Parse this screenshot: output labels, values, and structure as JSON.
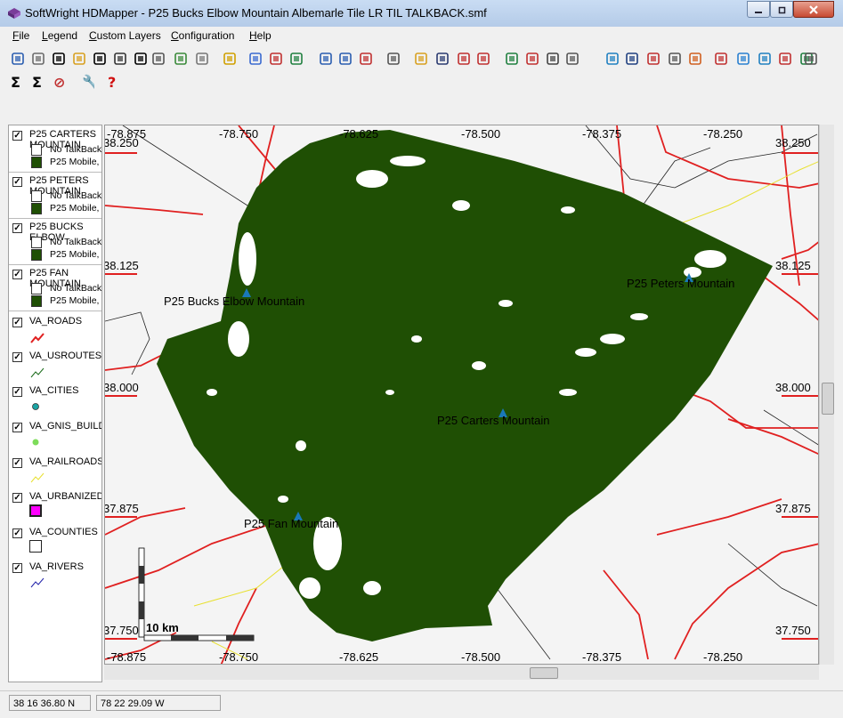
{
  "window": {
    "title": "SoftWright HDMapper - P25 Bucks Elbow Mountain Albemarle Tile LR TIL TALKBACK.smf"
  },
  "menu": [
    "File",
    "Legend",
    "Custom Layers",
    "Configuration",
    "Help"
  ],
  "toolbar_icons": [
    "zoom-area-icon",
    "pan-hand-icon",
    "info-icon",
    "label-icon",
    "text-icon",
    "resize-icon",
    "select-arrow-icon",
    "edit-point-icon",
    "profile-icon",
    "image-icon",
    "pencil-icon",
    "layers-a-icon",
    "layers-b-icon",
    "layers-c-icon",
    "zoom-in-icon",
    "zoom-out-icon",
    "zoom-cancel-icon",
    "print-icon",
    "open-folder-icon",
    "save-icon",
    "export-icon",
    "import-icon",
    "checklist-icon",
    "convert-icon",
    "dxf-icon",
    "compass-icon",
    "globe-color-icon",
    "globe-icon",
    "grid-color-icon",
    "table-icon",
    "paint-icon",
    "add-layer-icon",
    "layer-stack-icon",
    "layer-fill-icon",
    "points-icon",
    "crop-icon",
    "notes-icon"
  ],
  "toolbar2_icons": [
    "sum-icon",
    "sum-edit-icon",
    "stop-icon",
    "wrench-icon",
    "help-icon"
  ],
  "legend": {
    "coverage_layers": [
      {
        "name": "P25 CARTERS MOUNTAIN",
        "checked": true,
        "no_talkback": "No TalkBack",
        "mobile": "P25 Mobile,",
        "mobile_color": "#1f4f04"
      },
      {
        "name": "P25 PETERS MOUNTAIN",
        "checked": true,
        "no_talkback": "No TalkBack",
        "mobile": "P25 Mobile,",
        "mobile_color": "#1f4f04"
      },
      {
        "name": "P25 BUCKS ELBOW",
        "checked": true,
        "no_talkback": "No TalkBack",
        "mobile": "P25 Mobile,",
        "mobile_color": "#1f4f04"
      },
      {
        "name": "P25 FAN MOUNTAIN",
        "checked": true,
        "no_talkback": "No TalkBack",
        "mobile": "P25 Mobile,",
        "mobile_color": "#1f4f04"
      }
    ],
    "vector_layers": [
      {
        "name": "VA_ROADS",
        "checked": true,
        "symbol": "road-line-icon",
        "color": "#e02020"
      },
      {
        "name": "VA_USROUTES",
        "checked": true,
        "symbol": "route-line-icon",
        "color": "#1a6b1a"
      },
      {
        "name": "VA_CITIES",
        "checked": true,
        "symbol": "city-dot-icon",
        "color": "#1aa3a3"
      },
      {
        "name": "VA_GNIS_BUILDINGS",
        "checked": true,
        "symbol": "building-dot-icon",
        "color": "#7ddc5a"
      },
      {
        "name": "VA_RAILROADS",
        "checked": true,
        "symbol": "railroad-line-icon",
        "color": "#e8e030"
      },
      {
        "name": "VA_URBANIZED",
        "checked": true,
        "symbol": "urban-fill-icon",
        "color": "#ff00ff"
      },
      {
        "name": "VA_COUNTIES",
        "checked": true,
        "symbol": "county-box-icon",
        "color": "#ffffff"
      },
      {
        "name": "VA_RIVERS",
        "checked": true,
        "symbol": "river-line-icon",
        "color": "#2222aa"
      }
    ]
  },
  "map": {
    "lon_ticks": [
      "-78.875",
      "-78.750",
      "-78.625",
      "-78.500",
      "-78.375",
      "-78.250"
    ],
    "lat_ticks": [
      "38.250",
      "38.125",
      "38.000",
      "37.875",
      "37.750"
    ],
    "sites": [
      {
        "name": "P25 Bucks Elbow Mountain"
      },
      {
        "name": "P25 Peters Mountain"
      },
      {
        "name": "P25 Carters Mountain"
      },
      {
        "name": "P25 Fan Mountain"
      }
    ],
    "scale_label": "10 km",
    "coverage_color": "#1f4f04"
  },
  "status": {
    "lat": "38 16 36.80 N",
    "lon": "78 22 29.09 W"
  }
}
